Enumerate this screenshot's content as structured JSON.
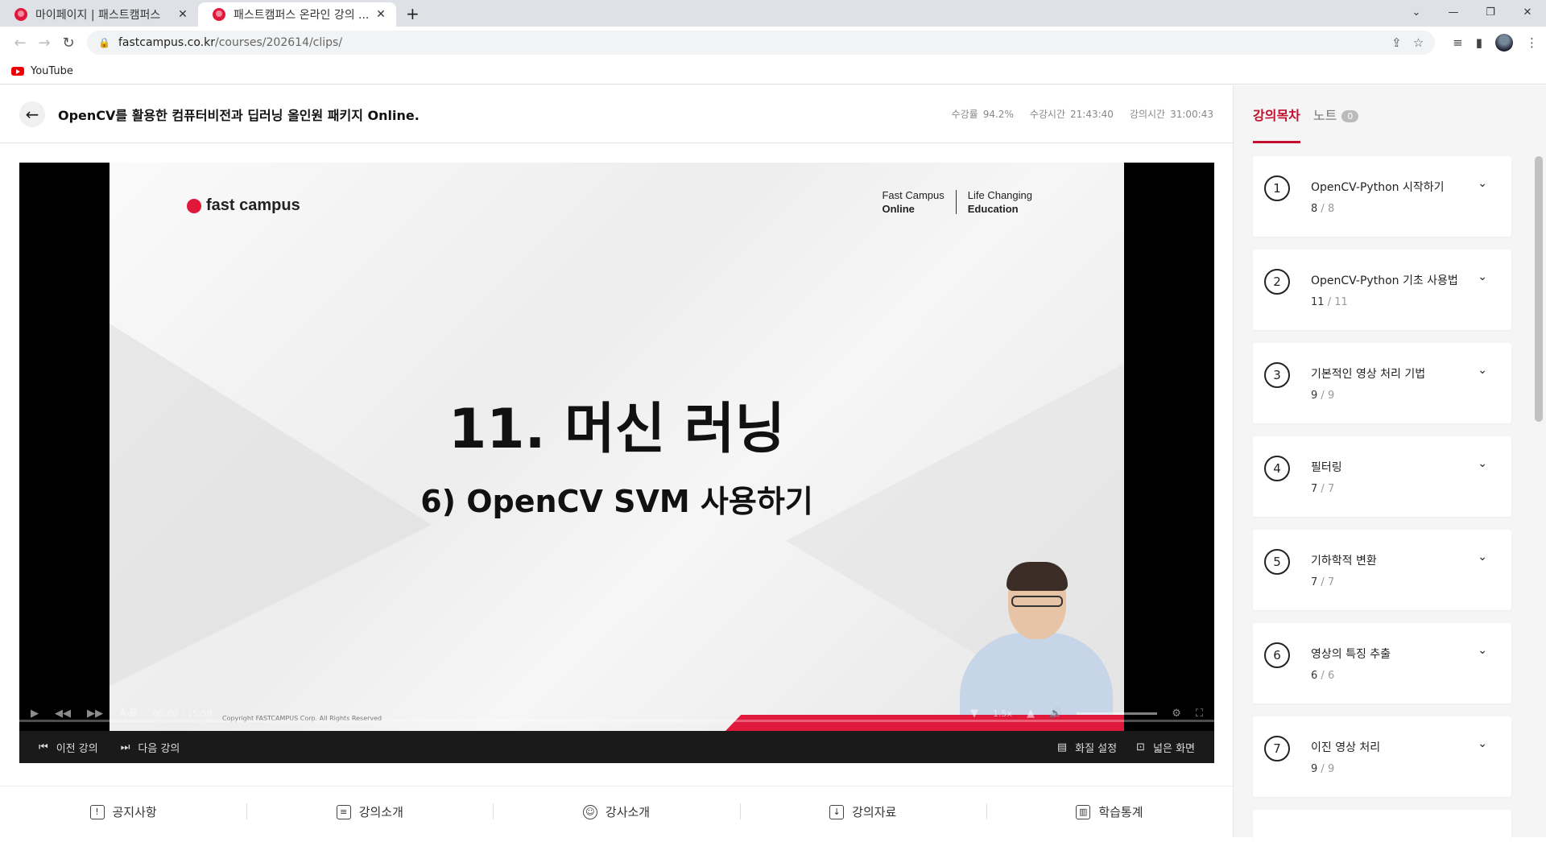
{
  "browser": {
    "tabs": [
      {
        "title": "마이페이지 | 패스트캠퍼스",
        "active": false
      },
      {
        "title": "패스트캠퍼스 온라인 강의 ...",
        "active": true
      }
    ],
    "url_host": "fastcampus.co.kr",
    "url_path": "/courses/202614/clips/",
    "bookmark": "YouTube"
  },
  "course": {
    "title": "OpenCV를 활용한 컴퓨터비전과 딥러닝 올인원 패키지 Online.",
    "stats": [
      {
        "label": "수강률",
        "value": "94.2%"
      },
      {
        "label": "수강시간",
        "value": "21:43:40"
      },
      {
        "label": "강의시간",
        "value": "31:00:43"
      }
    ]
  },
  "video": {
    "logo": "fast campus",
    "brand_left_1": "Fast Campus",
    "brand_left_2": "Online",
    "brand_right_1": "Life Changing",
    "brand_right_2": "Education",
    "heading": "11. 머신 러닝",
    "subheading": "6) OpenCV SVM 사용하기",
    "copyright": "Copyright FASTCAMPUS Corp. All Rights Reserved",
    "ab_label": "A-B",
    "time": "00:00  /  15:58",
    "speed": "1.5x",
    "progress_fraction": 0.0
  },
  "player_bar": {
    "prev": "이전 강의",
    "next": "다음 강의",
    "quality": "화질 설정",
    "wide": "넓은 화면"
  },
  "bottom_tabs": [
    "공지사항",
    "강의소개",
    "강사소개",
    "강의자료",
    "학습통계"
  ],
  "sidebar": {
    "tab_toc": "강의목차",
    "tab_note": "노트",
    "note_count": "0",
    "sections": [
      {
        "num": "1",
        "name": "OpenCV-Python 시작하기",
        "done": "8",
        "total": "8"
      },
      {
        "num": "2",
        "name": "OpenCV-Python 기초 사용법",
        "done": "11",
        "total": "11"
      },
      {
        "num": "3",
        "name": "기본적인 영상 처리 기법",
        "done": "9",
        "total": "9"
      },
      {
        "num": "4",
        "name": "필터링",
        "done": "7",
        "total": "7"
      },
      {
        "num": "5",
        "name": "기하학적 변환",
        "done": "7",
        "total": "7"
      },
      {
        "num": "6",
        "name": "영상의 특징 추출",
        "done": "6",
        "total": "6"
      },
      {
        "num": "7",
        "name": "이진 영상 처리",
        "done": "9",
        "total": "9"
      }
    ]
  }
}
